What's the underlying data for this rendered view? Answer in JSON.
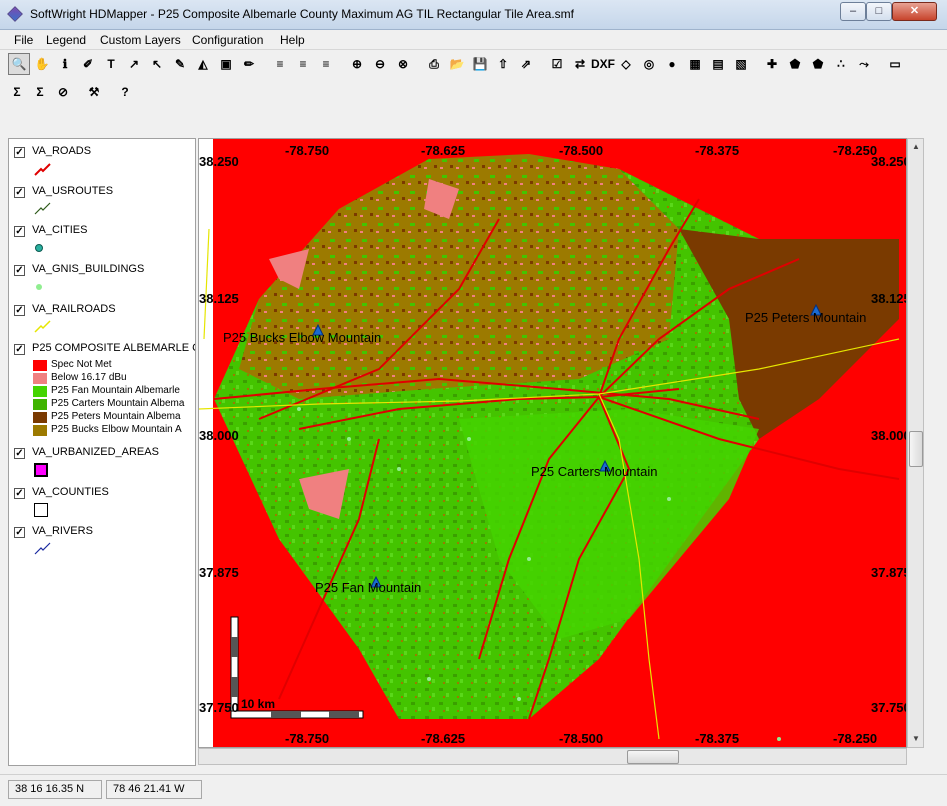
{
  "window": {
    "title": "SoftWright HDMapper - P25 Composite Albemarle County Maximum AG TIL Rectangular Tile Area.smf",
    "minimize": "–",
    "maximize": "□",
    "close": "✕"
  },
  "menu": [
    "File",
    "Legend",
    "Custom Layers",
    "Configuration",
    "Help"
  ],
  "toolbar_row1": [
    {
      "icon": "zoom-tool-icon",
      "glyph": "🔍"
    },
    {
      "icon": "pan-hand-icon",
      "glyph": "✋"
    },
    {
      "icon": "info-icon",
      "glyph": "ℹ"
    },
    {
      "icon": "label-icon",
      "glyph": "✐"
    },
    {
      "icon": "text-tool-icon",
      "glyph": "T"
    },
    {
      "icon": "resize-icon",
      "glyph": "↗"
    },
    {
      "icon": "select-arrow-icon",
      "glyph": "↖"
    },
    {
      "icon": "point-select-icon",
      "glyph": "✎"
    },
    {
      "icon": "profile-icon",
      "glyph": "◭"
    },
    {
      "icon": "draw-region-icon",
      "glyph": "▣"
    },
    {
      "icon": "pencil-icon",
      "glyph": "✏"
    },
    {
      "icon": "layers-icon",
      "glyph": "≡"
    },
    {
      "icon": "layers-edit-icon",
      "glyph": "≡"
    },
    {
      "icon": "layers-color-icon",
      "glyph": "≡"
    },
    {
      "icon": "zoom-in-icon",
      "glyph": "⊕"
    },
    {
      "icon": "zoom-out-icon",
      "glyph": "⊖"
    },
    {
      "icon": "zoom-cancel-icon",
      "glyph": "⊗"
    },
    {
      "icon": "print-icon",
      "glyph": "⎙"
    },
    {
      "icon": "open-folder-icon",
      "glyph": "📂"
    },
    {
      "icon": "save-icon",
      "glyph": "💾"
    },
    {
      "icon": "export-icon",
      "glyph": "⇧"
    },
    {
      "icon": "export-arrow-icon",
      "glyph": "⇗"
    },
    {
      "icon": "checklist-icon",
      "glyph": "☑"
    },
    {
      "icon": "convert-icon",
      "glyph": "⇄"
    },
    {
      "icon": "dxf-icon",
      "glyph": "DXF"
    },
    {
      "icon": "compass-icon",
      "glyph": "◇"
    },
    {
      "icon": "target-icon",
      "glyph": "◎"
    },
    {
      "icon": "globe-icon",
      "glyph": "●"
    },
    {
      "icon": "palette-grid-icon",
      "glyph": "▦"
    },
    {
      "icon": "display-icon",
      "glyph": "▤"
    },
    {
      "icon": "map-edit-icon",
      "glyph": "▧"
    },
    {
      "icon": "add-layer-icon",
      "glyph": "✚"
    },
    {
      "icon": "layer-stack-icon",
      "glyph": "⬟"
    },
    {
      "icon": "layer-stack-alt-icon",
      "glyph": "⬟"
    },
    {
      "icon": "points-icon",
      "glyph": "∴"
    },
    {
      "icon": "route-icon",
      "glyph": "⤳"
    },
    {
      "icon": "window-icon",
      "glyph": "▭"
    }
  ],
  "toolbar_row2": [
    {
      "icon": "sum-icon",
      "glyph": "Σ"
    },
    {
      "icon": "sum-edit-icon",
      "glyph": "Σ"
    },
    {
      "icon": "filter-icon",
      "glyph": "⊘"
    },
    {
      "icon": "wrench-icon",
      "glyph": "⚒"
    },
    {
      "icon": "help-icon",
      "glyph": "?"
    }
  ],
  "legend": {
    "layers": [
      {
        "name": "VA_ROADS",
        "checked": "✓",
        "symbol": "road-line-icon"
      },
      {
        "name": "VA_USROUTES",
        "checked": "✓",
        "symbol": "usroute-line-icon"
      },
      {
        "name": "VA_CITIES",
        "checked": "✓",
        "symbol": "city-dot-icon"
      },
      {
        "name": "VA_GNIS_BUILDINGS",
        "checked": "✓",
        "symbol": "building-dot-icon"
      },
      {
        "name": "VA_RAILROADS",
        "checked": "✓",
        "symbol": "railroad-line-icon"
      },
      {
        "name": "P25 COMPOSITE ALBEMARLE C",
        "checked": "✓",
        "symbol": "raster-icon"
      },
      {
        "name": "VA_URBANIZED_AREAS",
        "checked": "✓",
        "symbol": "urban-box-icon"
      },
      {
        "name": "VA_COUNTIES",
        "checked": "✓",
        "symbol": "county-box-icon"
      },
      {
        "name": "VA_RIVERS",
        "checked": "✓",
        "symbol": "river-line-icon"
      }
    ],
    "composite_classes": [
      {
        "label": "Spec Not Met",
        "color": "#ff0000"
      },
      {
        "label": "Below 16.17 dBu",
        "color": "#f08080"
      },
      {
        "label": "P25 Fan Mountain Albemarle",
        "color": "#44d400"
      },
      {
        "label": "P25 Carters Mountain Albema",
        "color": "#3fb400"
      },
      {
        "label": "P25 Peters Mountain Albema",
        "color": "#7a3a00"
      },
      {
        "label": "P25 Bucks Elbow Mountain A",
        "color": "#9c7a00"
      }
    ]
  },
  "map": {
    "lon_labels": [
      "-78.750",
      "-78.625",
      "-78.500",
      "-78.375",
      "-78.250"
    ],
    "lat_labels": [
      "38.250",
      "38.125",
      "38.000",
      "37.875",
      "37.750"
    ],
    "sites": [
      {
        "name": "P25 Bucks Elbow Mountain"
      },
      {
        "name": "P25 Peters Mountain"
      },
      {
        "name": "P25 Carters Mountain"
      },
      {
        "name": "P25 Fan Mountain"
      }
    ],
    "scale_label": "10 km"
  },
  "status": {
    "latitude": "38 16 16.35 N",
    "longitude": "78 46 21.41 W"
  }
}
